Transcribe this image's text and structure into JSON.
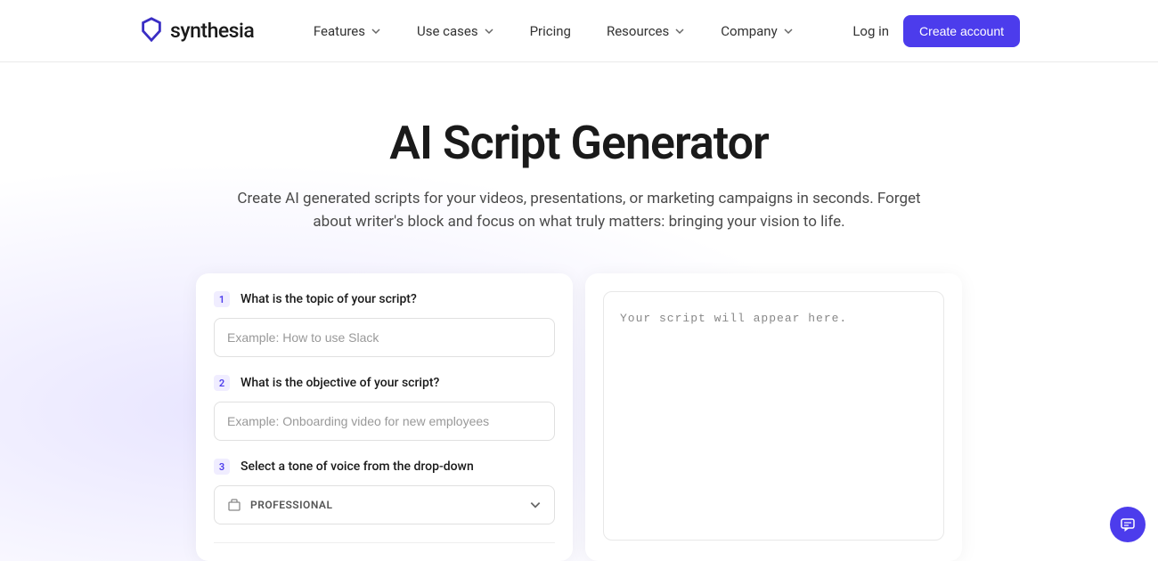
{
  "brand": "synthesia",
  "nav": {
    "features": "Features",
    "usecases": "Use cases",
    "pricing": "Pricing",
    "resources": "Resources",
    "company": "Company"
  },
  "header": {
    "login": "Log in",
    "create": "Create account"
  },
  "page": {
    "title": "AI Script Generator",
    "subtitle": "Create AI generated scripts for your videos, presentations, or marketing campaigns in seconds. Forget about writer's block and focus on what truly matters: bringing your vision to life."
  },
  "form": {
    "step1": {
      "num": "1",
      "label": "What is the topic of your script?",
      "placeholder": "Example: How to use Slack"
    },
    "step2": {
      "num": "2",
      "label": "What is the objective of your script?",
      "placeholder": "Example: Onboarding video for new employees"
    },
    "step3": {
      "num": "3",
      "label": "Select a tone of voice from the drop-down",
      "selected": "PROFESSIONAL"
    }
  },
  "output": {
    "placeholder": "Your script will appear here."
  }
}
